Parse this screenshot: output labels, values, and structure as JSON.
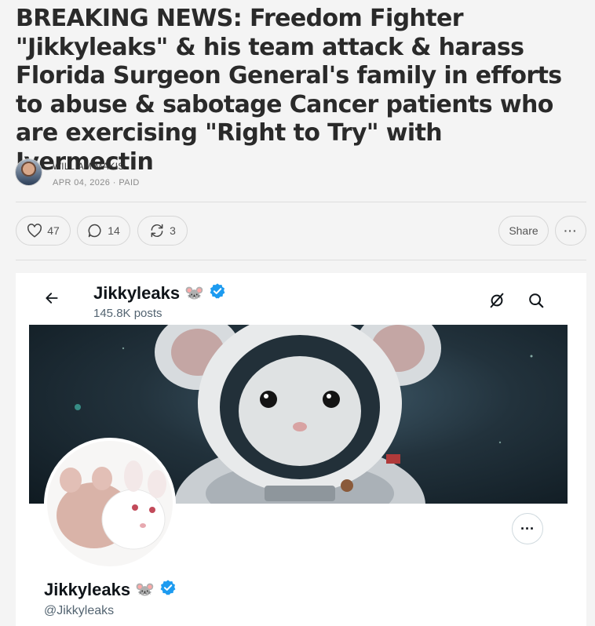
{
  "article": {
    "title": "BREAKING NEWS: Freedom Fighter \"Jikkyleaks\" & his team attack & harass Florida Surgeon General's family in efforts to abuse & sabotage Cancer patients who are exercising \"Right to Try\" with Ivermectin",
    "author": "WILLIAM MAKIS",
    "date": "APR 04, 2026",
    "separator": "·",
    "access": "PAID"
  },
  "actions": {
    "likes": "47",
    "comments": "14",
    "restacks": "3",
    "share_label": "Share",
    "more_label": "···",
    "like_icon": "heart-icon",
    "comment_icon": "speech-bubble-icon",
    "restack_icon": "refresh-icon"
  },
  "embed": {
    "name": "Jikkyleaks",
    "emoji": "🐭",
    "posts": "145.8K posts",
    "handle": "@Jikkyleaks",
    "more_label": "···",
    "verified_color": "#1d9bf0",
    "banner_subject": "mouse in astronaut suit",
    "avatar_subject": "two mice"
  }
}
